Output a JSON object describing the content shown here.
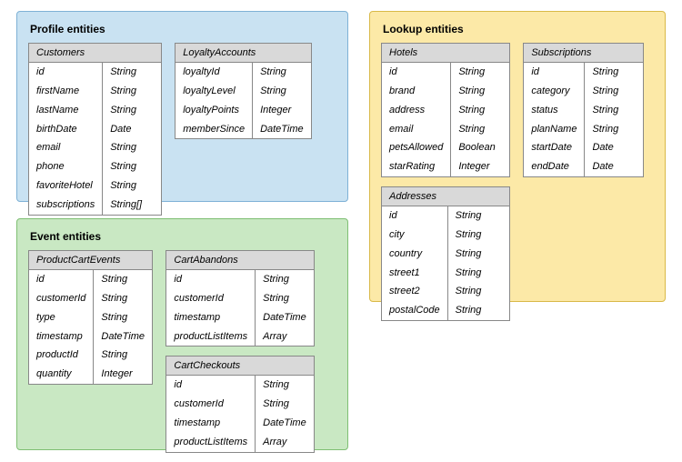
{
  "groups": {
    "profile": {
      "title": "Profile entities",
      "tables": {
        "customers": {
          "name": "Customers",
          "fields": [
            {
              "n": "id",
              "t": "String"
            },
            {
              "n": "firstName",
              "t": "String"
            },
            {
              "n": "lastName",
              "t": "String"
            },
            {
              "n": "birthDate",
              "t": "Date"
            },
            {
              "n": "email",
              "t": "String"
            },
            {
              "n": "phone",
              "t": "String"
            },
            {
              "n": "favoriteHotel",
              "t": "String"
            },
            {
              "n": "subscriptions",
              "t": "String[]"
            }
          ]
        },
        "loyalty": {
          "name": "LoyaltyAccounts",
          "fields": [
            {
              "n": "loyaltyId",
              "t": "String"
            },
            {
              "n": "loyaltyLevel",
              "t": "String"
            },
            {
              "n": "loyaltyPoints",
              "t": "Integer"
            },
            {
              "n": "memberSince",
              "t": "DateTime"
            }
          ]
        }
      }
    },
    "event": {
      "title": "Event entities",
      "tables": {
        "productCart": {
          "name": "ProductCartEvents",
          "fields": [
            {
              "n": "id",
              "t": "String"
            },
            {
              "n": "customerId",
              "t": "String"
            },
            {
              "n": "type",
              "t": "String"
            },
            {
              "n": "timestamp",
              "t": "DateTime"
            },
            {
              "n": "productId",
              "t": "String"
            },
            {
              "n": "quantity",
              "t": "Integer"
            }
          ]
        },
        "cartAbandons": {
          "name": "CartAbandons",
          "fields": [
            {
              "n": "id",
              "t": "String"
            },
            {
              "n": "customerId",
              "t": "String"
            },
            {
              "n": "timestamp",
              "t": "DateTime"
            },
            {
              "n": "productListItems",
              "t": "Array"
            }
          ]
        },
        "cartCheckouts": {
          "name": "CartCheckouts",
          "fields": [
            {
              "n": "id",
              "t": "String"
            },
            {
              "n": "customerId",
              "t": "String"
            },
            {
              "n": "timestamp",
              "t": "DateTime"
            },
            {
              "n": "productListItems",
              "t": "Array"
            }
          ]
        }
      }
    },
    "lookup": {
      "title": "Lookup entities",
      "tables": {
        "hotels": {
          "name": "Hotels",
          "fields": [
            {
              "n": "id",
              "t": "String"
            },
            {
              "n": "brand",
              "t": "String"
            },
            {
              "n": "address",
              "t": "String"
            },
            {
              "n": "email",
              "t": "String"
            },
            {
              "n": "petsAllowed",
              "t": "Boolean"
            },
            {
              "n": "starRating",
              "t": "Integer"
            }
          ]
        },
        "subscriptions": {
          "name": "Subscriptions",
          "fields": [
            {
              "n": "id",
              "t": "String"
            },
            {
              "n": "category",
              "t": "String"
            },
            {
              "n": "status",
              "t": "String"
            },
            {
              "n": "planName",
              "t": "String"
            },
            {
              "n": "startDate",
              "t": "Date"
            },
            {
              "n": "endDate",
              "t": "Date"
            }
          ]
        },
        "addresses": {
          "name": "Addresses",
          "fields": [
            {
              "n": "id",
              "t": "String"
            },
            {
              "n": "city",
              "t": "String"
            },
            {
              "n": "country",
              "t": "String"
            },
            {
              "n": "street1",
              "t": "String"
            },
            {
              "n": "street2",
              "t": "String"
            },
            {
              "n": "postalCode",
              "t": "String"
            }
          ]
        }
      }
    }
  }
}
